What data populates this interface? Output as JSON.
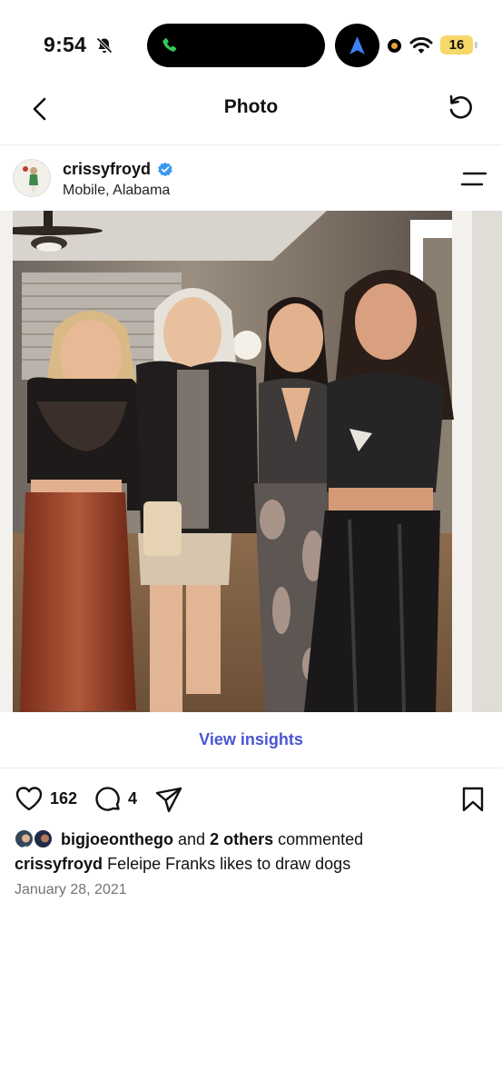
{
  "status_bar": {
    "time": "9:54",
    "battery": "16",
    "icons": [
      "bell-slash-icon",
      "phone-icon",
      "location-arrow-icon",
      "record-dot-icon",
      "wifi-icon",
      "battery-icon"
    ]
  },
  "header": {
    "title": "Photo",
    "back_icon": "chevron-left-icon",
    "refresh_icon": "refresh-icon"
  },
  "post": {
    "username": "crissyfroyd",
    "verified": true,
    "location": "Mobile, Alabama",
    "menu_icon": "menu-icon",
    "photo_description_icon": "group-photo-image"
  },
  "insights": {
    "label": "View insights"
  },
  "actions": {
    "like_count": "162",
    "comment_count": "4",
    "icons": [
      "heart-icon",
      "comment-icon",
      "share-icon",
      "bookmark-icon"
    ]
  },
  "comments_summary": {
    "user": "bigjoeonthego",
    "connector": "and",
    "others": "2 others",
    "suffix": "commented"
  },
  "caption": {
    "username": "crissyfroyd",
    "text": "Feleipe Franks likes to draw dogs"
  },
  "date": "January 28, 2021",
  "colors": {
    "link": "#4a56d4",
    "verified": "#3897f0",
    "battery": "#f6d86a",
    "island_phone": "#34c759",
    "nav_arrow": "#3b82f6"
  }
}
